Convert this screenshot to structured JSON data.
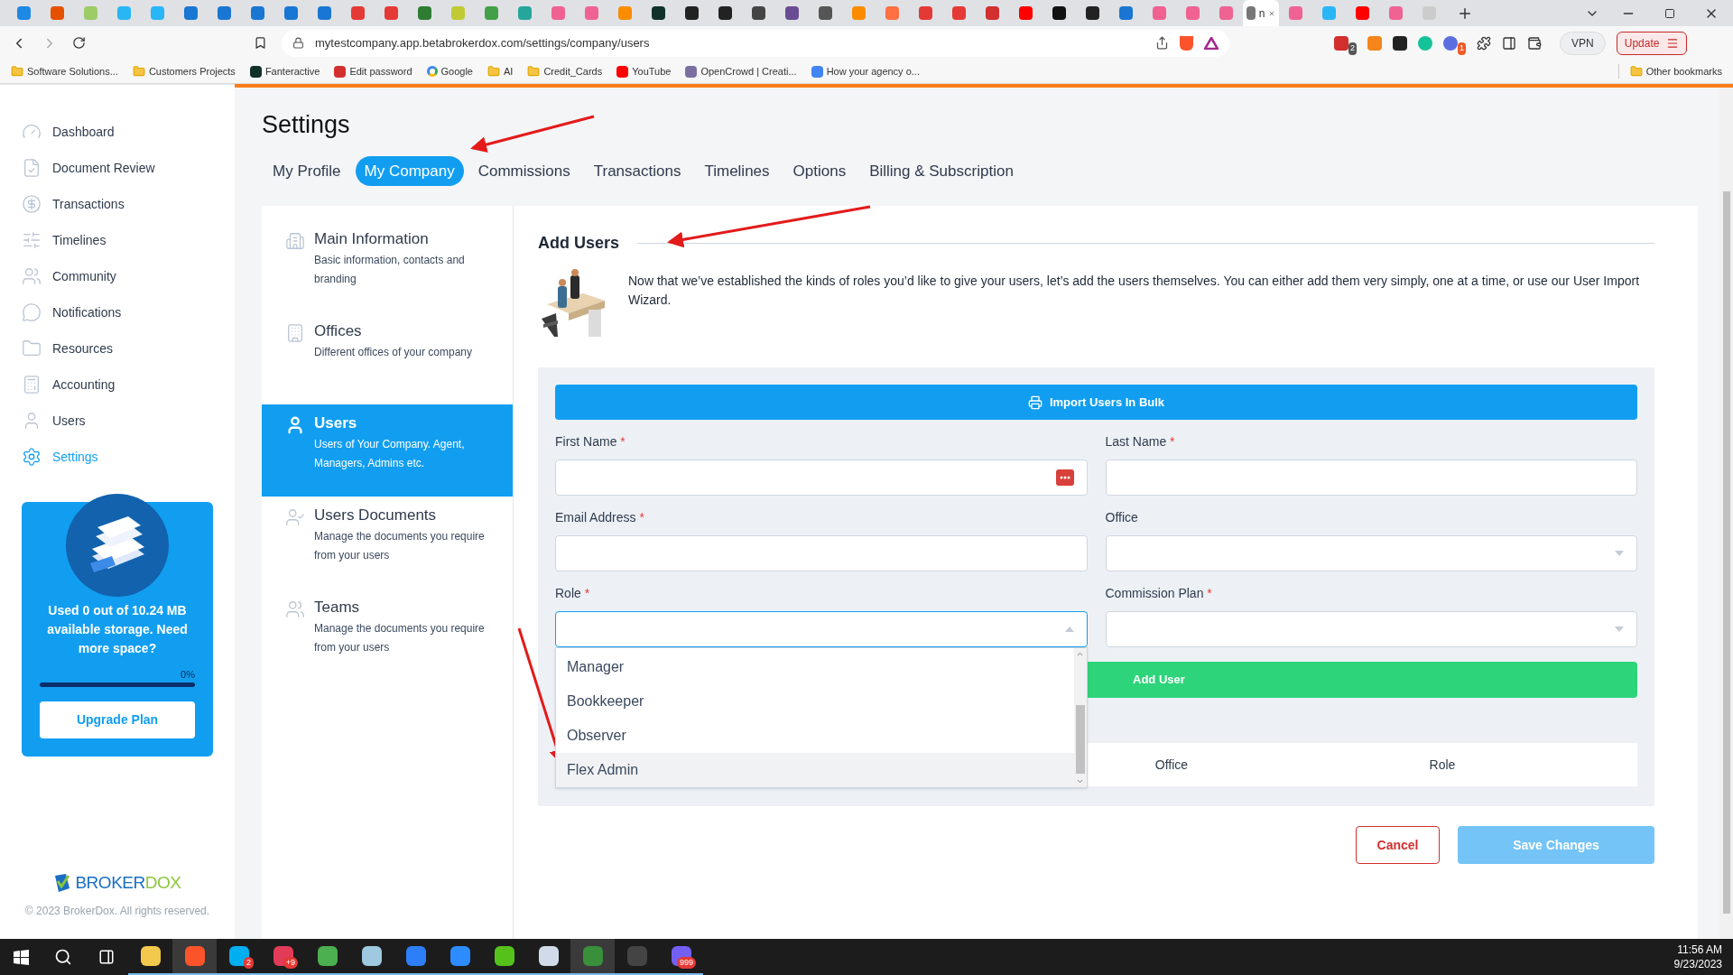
{
  "browser": {
    "tabs": [
      {
        "color": "#1e88e5",
        "selected": false
      },
      {
        "color": "#e65100",
        "selected": false
      },
      {
        "color": "#9ccc65",
        "selected": false
      },
      {
        "color": "#29b6f6",
        "selected": false
      },
      {
        "color": "#29b6f6",
        "selected": false
      },
      {
        "color": "#1976d2",
        "selected": false
      },
      {
        "color": "#1976d2",
        "selected": false
      },
      {
        "color": "#1976d2",
        "selected": false
      },
      {
        "color": "#1976d2",
        "selected": false
      },
      {
        "color": "#1976d2",
        "selected": false
      },
      {
        "color": "#e53935",
        "selected": false
      },
      {
        "color": "#e53935",
        "selected": false
      },
      {
        "color": "#2e7d32",
        "selected": false
      },
      {
        "color": "#c0ca33",
        "selected": false
      },
      {
        "color": "#43a047",
        "selected": false
      },
      {
        "color": "#26a69a",
        "selected": false
      },
      {
        "color": "#f06292",
        "selected": false
      },
      {
        "color": "#f06292",
        "selected": false
      },
      {
        "color": "#fb8c00",
        "selected": false
      },
      {
        "color": "#10302a",
        "selected": false
      },
      {
        "color": "#222222",
        "selected": false
      },
      {
        "color": "#222222",
        "selected": false
      },
      {
        "color": "#444444",
        "selected": false
      },
      {
        "color": "#6a4c93",
        "selected": false
      },
      {
        "color": "#555555",
        "selected": false
      },
      {
        "color": "#fb8c00",
        "selected": false
      },
      {
        "color": "#ff7043",
        "selected": false
      },
      {
        "color": "#e53935",
        "selected": false
      },
      {
        "color": "#e53935",
        "selected": false
      },
      {
        "color": "#d32f2f",
        "selected": false
      },
      {
        "color": "#ff0000",
        "selected": false
      },
      {
        "color": "#111111",
        "selected": false
      },
      {
        "color": "#222222",
        "selected": false
      },
      {
        "color": "#1976d2",
        "selected": false
      },
      {
        "color": "#f06292",
        "selected": false
      },
      {
        "color": "#f06292",
        "selected": false
      },
      {
        "color": "#f06292",
        "selected": false
      },
      {
        "title": "n",
        "color": "#777777",
        "selected": true
      },
      {
        "color": "#f06292",
        "selected": false
      },
      {
        "color": "#29b6f6",
        "selected": false
      },
      {
        "color": "#ff0000",
        "selected": false
      },
      {
        "color": "#f06292",
        "selected": false
      },
      {
        "color": "#cccccc",
        "selected": false
      }
    ],
    "address": "mytestcompany.app.betabrokerdox.com/settings/company/users",
    "extension_badges": [
      "2",
      "1"
    ],
    "vpn": "VPN",
    "update": "Update",
    "bookmarks": [
      {
        "label": "Software Solutions...",
        "kind": "folder"
      },
      {
        "label": "Customers Projects",
        "kind": "folder"
      },
      {
        "label": "Fanteractive",
        "kind": "site",
        "color": "#10302a"
      },
      {
        "label": "Edit password",
        "kind": "site",
        "color": "#d32f2f"
      },
      {
        "label": "Google",
        "kind": "google"
      },
      {
        "label": "AI",
        "kind": "folder"
      },
      {
        "label": "Credit_Cards",
        "kind": "folder"
      },
      {
        "label": "YouTube",
        "kind": "site",
        "color": "#ff0000"
      },
      {
        "label": "OpenCrowd | Creati...",
        "kind": "site",
        "color": "#7a6fa0"
      },
      {
        "label": "How your agency o...",
        "kind": "site",
        "color": "#4285f4"
      }
    ],
    "other_bookmarks": "Other bookmarks"
  },
  "sidebar": {
    "items": [
      {
        "label": "Dashboard",
        "selected": false
      },
      {
        "label": "Document Review",
        "selected": false
      },
      {
        "label": "Transactions",
        "selected": false
      },
      {
        "label": "Timelines",
        "selected": false
      },
      {
        "label": "Community",
        "selected": false
      },
      {
        "label": "Notifications",
        "selected": false
      },
      {
        "label": "Resources",
        "selected": false
      },
      {
        "label": "Accounting",
        "selected": false
      },
      {
        "label": "Users",
        "selected": false
      },
      {
        "label": "Settings",
        "selected": true
      }
    ],
    "storage": {
      "text": "Used **0** out of **10.24 MB** available storage. Need more space?",
      "percent": "0%",
      "level": 0,
      "button": "Upgrade Plan"
    },
    "logo": [
      "BROKER",
      "DOX"
    ],
    "copyright": "© 2023 BrokerDox. All rights reserved."
  },
  "page": {
    "title": "Settings",
    "tabs": [
      {
        "label": "My Profile",
        "selected": false
      },
      {
        "label": "My Company",
        "selected": true
      },
      {
        "label": "Commissions",
        "selected": false
      },
      {
        "label": "Transactions",
        "selected": false
      },
      {
        "label": "Timelines",
        "selected": false
      },
      {
        "label": "Options",
        "selected": false
      },
      {
        "label": "Billing & Subscription",
        "selected": false
      }
    ],
    "settings_menu": [
      {
        "title": "Main Information",
        "description": "Basic information, contacts and branding",
        "selected": false
      },
      {
        "title": "Offices",
        "description": "Different offices of your company",
        "selected": false
      },
      {
        "title": "Users",
        "description": "Users of Your Company. Agent, Managers, Admins etc.",
        "selected": true
      },
      {
        "title": "Users Documents",
        "description": "Manage the documents you require from your users",
        "selected": false
      },
      {
        "title": "Teams",
        "description": "Manage the documents you require from your users",
        "selected": false
      }
    ],
    "section_title": "Add Users",
    "intro": "Now that we’ve established the kinds of roles you’d like to give your users, let’s add the users themselves. You can either add them very simply, one at a time, or use our User Import Wizard.",
    "import_button": "Import Users In Bulk",
    "fields": [
      {
        "label": "First Name",
        "required": true,
        "kind": "text",
        "password_manager_icon": true
      },
      {
        "label": "Last Name",
        "required": true,
        "kind": "text"
      },
      {
        "label": "Email Address",
        "required": true,
        "kind": "text"
      },
      {
        "label": "Office",
        "required": false,
        "kind": "select",
        "expanded": false
      },
      {
        "label": "Role",
        "required": true,
        "kind": "select",
        "expanded": true,
        "options": [
          {
            "label": "Manager",
            "highlighted": false
          },
          {
            "label": "Bookkeeper",
            "highlighted": false
          },
          {
            "label": "Observer",
            "highlighted": false
          },
          {
            "label": "Flex Admin",
            "highlighted": true
          }
        ]
      },
      {
        "label": "Commission Plan",
        "required": true,
        "kind": "select",
        "expanded": false
      }
    ],
    "required_mark": "*",
    "add_button": "Add User",
    "table": {
      "columns": [
        "Office",
        "Role"
      ]
    },
    "cancel": "Cancel",
    "save": {
      "label": "Save Changes",
      "disabled": true
    }
  },
  "taskbar": {
    "apps": [
      {
        "color": "#f2c94c",
        "active": false
      },
      {
        "color": "#fb542b",
        "active": true
      },
      {
        "color": "#00aff0",
        "badge": "2",
        "active": false
      },
      {
        "color": "#e23b57",
        "badge": "+9",
        "active": false
      },
      {
        "color": "#4caf50",
        "active": false
      },
      {
        "color": "#9ec9e0",
        "active": false
      },
      {
        "color": "#2d7ff9",
        "active": false
      },
      {
        "color": "#2d8cff",
        "active": false
      },
      {
        "color": "#55c21b",
        "active": false
      },
      {
        "color": "#d0dae8",
        "active": false
      },
      {
        "color": "#3a8f3a",
        "active": true
      },
      {
        "color": "#444444",
        "active": false
      },
      {
        "color": "#7360f2",
        "badge": "999",
        "active": false
      }
    ],
    "time": "11:56 AM",
    "date": "9/23/2023"
  }
}
